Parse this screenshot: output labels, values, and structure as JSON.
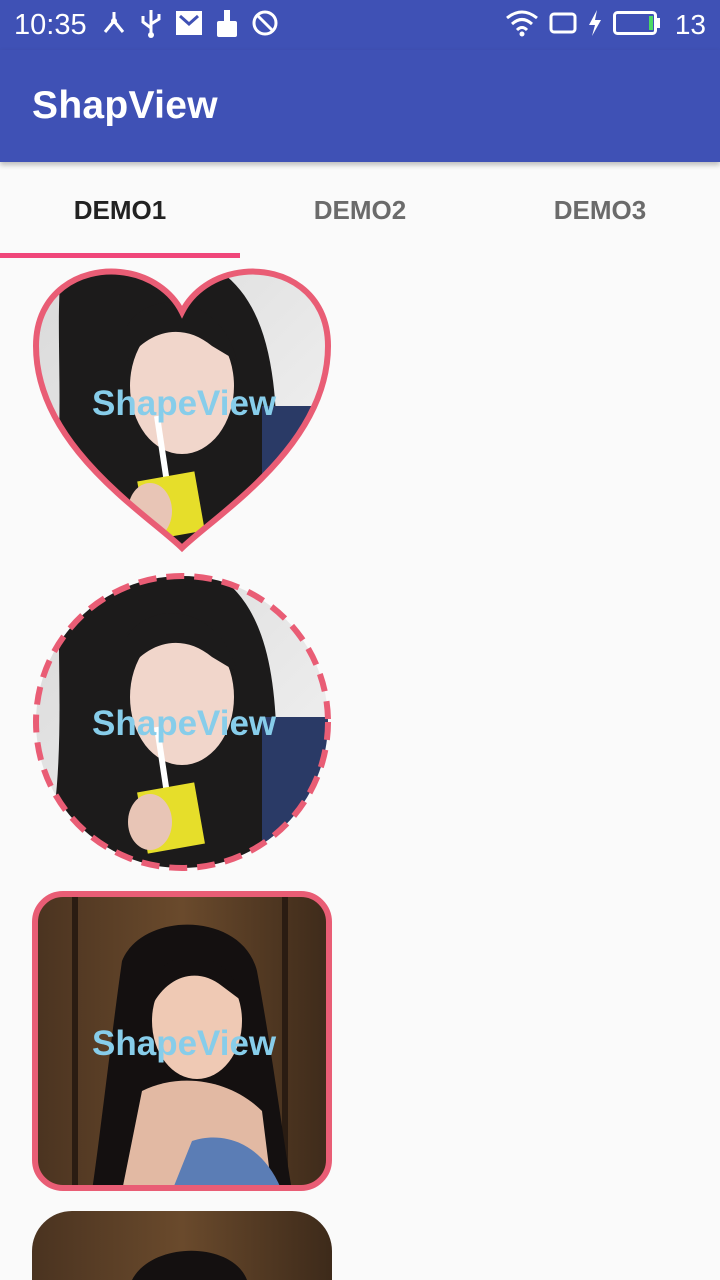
{
  "status_bar": {
    "time": "10:35",
    "battery_level": "13",
    "left_icons": [
      "usb-share-icon",
      "usb-icon",
      "mail-icon",
      "cleaner-icon",
      "block-icon"
    ],
    "right_icons": [
      "wifi-icon",
      "screen-rotate-icon",
      "charging-icon",
      "battery-icon"
    ]
  },
  "app_bar": {
    "title": "ShapView"
  },
  "tabs": [
    {
      "label": "DEMO1",
      "selected": true
    },
    {
      "label": "DEMO2",
      "selected": false
    },
    {
      "label": "DEMO3",
      "selected": false
    }
  ],
  "colors": {
    "primary": "#3f51b5",
    "tab_indicator": "#f0467a",
    "border": "#e95d75",
    "label": "#87cdea"
  },
  "shapes": [
    {
      "type": "heart",
      "label": "ShapeView",
      "border": "solid"
    },
    {
      "type": "circle",
      "label": "ShapeView",
      "border": "dashed"
    },
    {
      "type": "rounded-rect",
      "label": "ShapeView",
      "border": "solid"
    },
    {
      "type": "rounded-rect-partial",
      "label": "",
      "border": "none"
    }
  ]
}
